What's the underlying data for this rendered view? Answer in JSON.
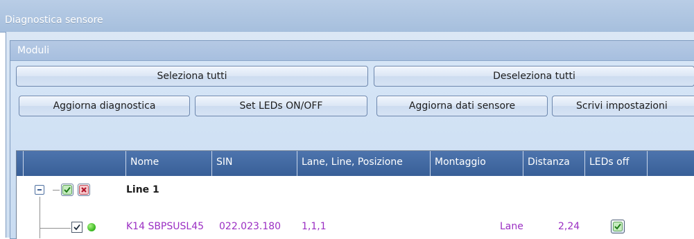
{
  "window": {
    "title": "Diagnostica sensore"
  },
  "group": {
    "title": "Moduli"
  },
  "buttons": {
    "select_all": "Seleziona tutti",
    "deselect_all": "Deseleziona tutti",
    "update_diagnostics": "Aggiorna diagnostica",
    "set_leds": "Set LEDs ON/OFF",
    "update_sensor_data": "Aggiorna dati sensore",
    "write_settings": "Scrivi impostazioni"
  },
  "table": {
    "columns": [
      "Nome",
      "SIN",
      "Lane, Line, Posizione",
      "Montaggio",
      "Distanza",
      "LEDs off"
    ],
    "groups": [
      {
        "label": "Line 1",
        "rows": [
          {
            "nome": "K14 SBPSUSL45",
            "sin": "022.023.180",
            "lane_line_posizione": "1,1,1",
            "montaggio": "Lane",
            "distanza": "2,24",
            "leds_off": true,
            "selected": true,
            "status": "online"
          }
        ]
      }
    ]
  },
  "colors": {
    "header_bg": "#3f67a2",
    "row_text": "#9b2fc3",
    "accent_light": "#d7e6f7"
  },
  "icons": {
    "expander": "collapse-minus-icon",
    "select_group": "check-all-icon",
    "deselect_group": "uncheck-all-icon",
    "status": "green-led-icon"
  }
}
